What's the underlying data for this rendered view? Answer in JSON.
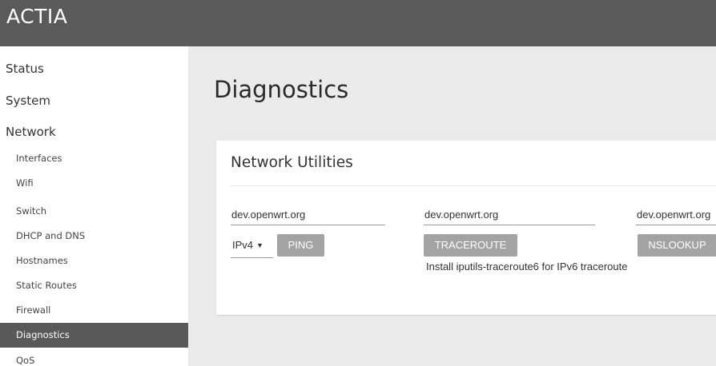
{
  "header": {
    "brand": "ACTIA"
  },
  "sidebar": {
    "top_items": [
      {
        "label": "Status"
      },
      {
        "label": "System"
      },
      {
        "label": "Network"
      }
    ],
    "network_items": [
      {
        "label": "Interfaces"
      },
      {
        "label": "Wifi"
      },
      {
        "label": "Switch"
      },
      {
        "label": "DHCP and DNS"
      },
      {
        "label": "Hostnames"
      },
      {
        "label": "Static Routes"
      },
      {
        "label": "Firewall"
      },
      {
        "label": "Diagnostics",
        "active": true
      },
      {
        "label": "QoS"
      }
    ]
  },
  "main": {
    "title": "Diagnostics",
    "card": {
      "title": "Network Utilities",
      "ping": {
        "host_value": "dev.openwrt.org",
        "protocol_selected": "IPv4",
        "button_label": "PING"
      },
      "traceroute": {
        "host_value": "dev.openwrt.org",
        "button_label": "TRACEROUTE",
        "note": "Install iputils-traceroute6 for IPv6 traceroute"
      },
      "nslookup": {
        "host_value": "dev.openwrt.org",
        "button_label": "NSLOOKUP"
      }
    }
  },
  "colors": {
    "header_bg": "#5a5a5a",
    "sidebar_active_bg": "#595959",
    "content_bg": "#ebebeb",
    "button_bg": "#a3a3a3"
  },
  "icons": {
    "select_caret": "caret-down-icon"
  }
}
